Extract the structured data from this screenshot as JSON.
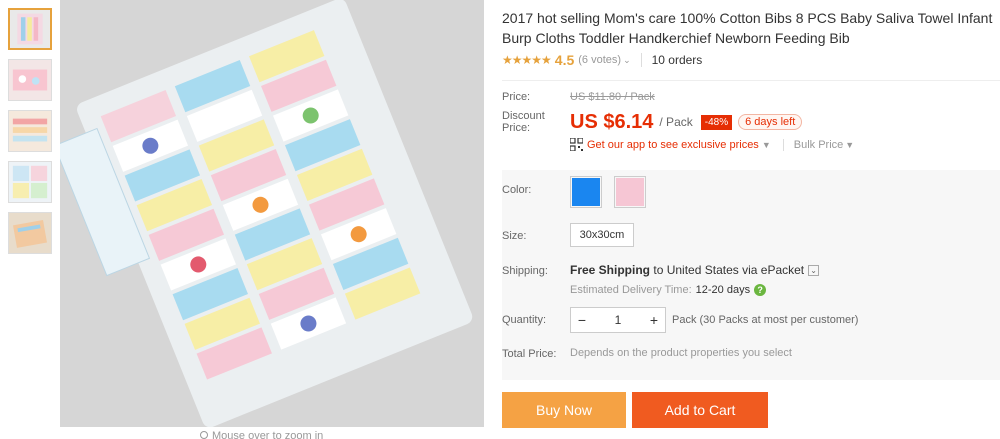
{
  "thumbnails": [
    {
      "name": "thumb-1",
      "active": true
    },
    {
      "name": "thumb-2",
      "active": false
    },
    {
      "name": "thumb-3",
      "active": false
    },
    {
      "name": "thumb-4",
      "active": false
    },
    {
      "name": "thumb-5",
      "active": false
    }
  ],
  "main_image": {
    "zoom_hint": "Mouse over to zoom in"
  },
  "product": {
    "title": "2017 hot selling Mom's care 100% Cotton Bibs 8 PCS Baby Saliva Towel Infant Burp Cloths Toddler Handkerchief Newborn Feeding Bib",
    "stars": "★★★★★",
    "rating": "4.5",
    "votes": "(6 votes)",
    "orders": "10 orders"
  },
  "pricing": {
    "price_label": "Price:",
    "original_price": "US $11.80 / Pack",
    "discount_label_1": "Discount",
    "discount_label_2": "Price:",
    "discount_price": "US $6.14",
    "unit": "/ Pack",
    "discount_badge": "-48%",
    "days_left": "6 days left",
    "app_promo": "Get our app to see exclusive prices",
    "bulk_price": "Bulk Price"
  },
  "options": {
    "color_label": "Color:",
    "colors": [
      "#1a86f0",
      "#f6c6d4"
    ],
    "size_label": "Size:",
    "size_value": "30x30cm"
  },
  "shipping": {
    "label": "Shipping:",
    "free_shipping": "Free Shipping",
    "to": "to",
    "destination": "United States via ePacket",
    "eta_label": "Estimated Delivery Time:",
    "eta_value": "12-20 days"
  },
  "quantity": {
    "label": "Quantity:",
    "value": "1",
    "minus": "−",
    "plus": "+",
    "note": "Pack (30 Packs at most per customer)"
  },
  "total": {
    "label": "Total Price:",
    "note": "Depends on the product properties you select"
  },
  "buttons": {
    "buy_now": "Buy Now",
    "add_to_cart": "Add to Cart"
  },
  "colors": {
    "price_red": "#e62e04",
    "rating_orange": "#e6a23c",
    "buy_now_bg": "#f5a244",
    "cart_bg": "#f05b20"
  }
}
